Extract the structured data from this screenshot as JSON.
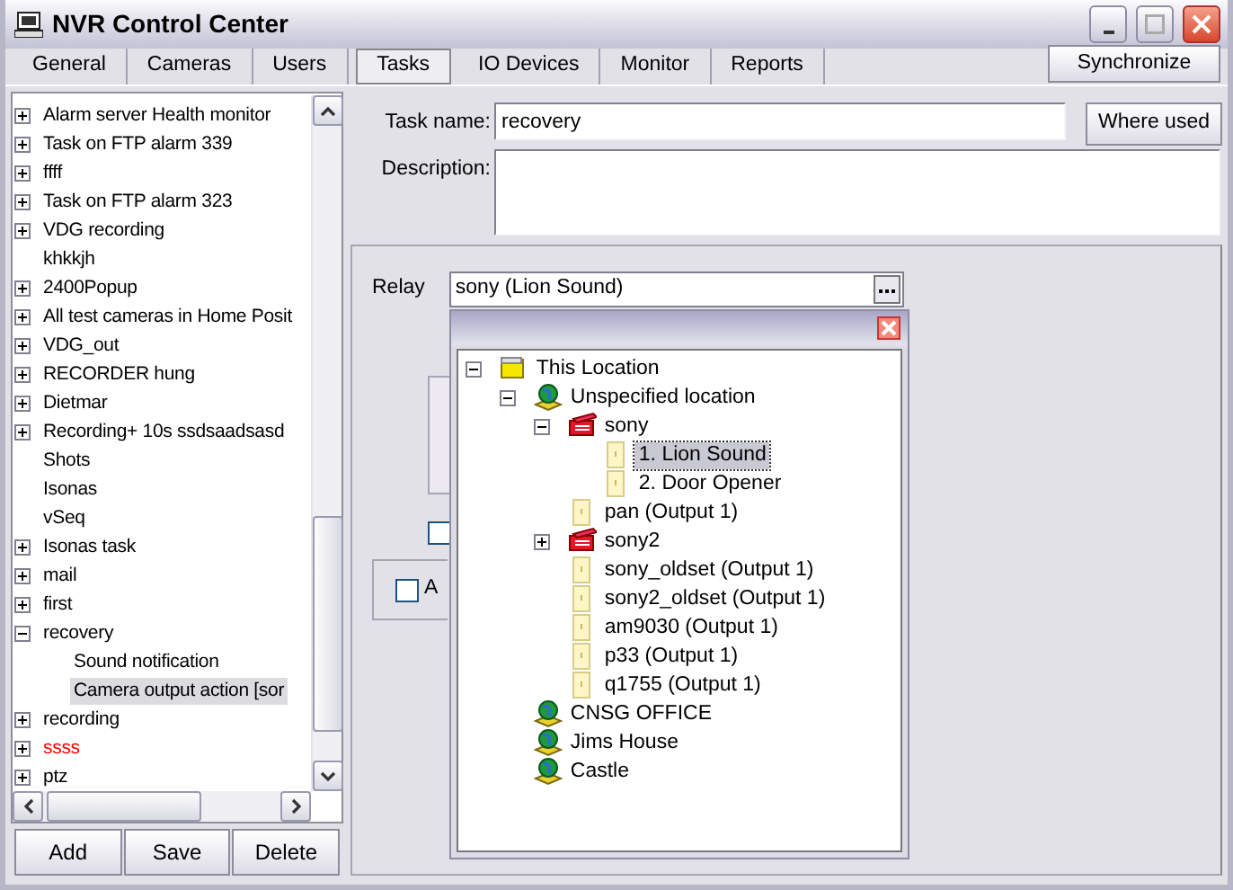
{
  "window": {
    "title": "NVR Control Center"
  },
  "tabs": [
    {
      "label": "General",
      "selected": false
    },
    {
      "label": "Cameras",
      "selected": false
    },
    {
      "label": "Users",
      "selected": false
    },
    {
      "label": "Tasks",
      "selected": true
    },
    {
      "label": "IO Devices",
      "selected": false
    },
    {
      "label": "Monitor",
      "selected": false
    },
    {
      "label": "Reports",
      "selected": false
    }
  ],
  "synchronize_button": "Synchronize",
  "task_tree": {
    "items": [
      {
        "label": "Alarm server Health monitor",
        "expanded": false,
        "selected": false
      },
      {
        "label": "Task on FTP alarm 339",
        "expanded": false,
        "selected": false
      },
      {
        "label": "ffff",
        "expanded": false,
        "selected": false
      },
      {
        "label": "Task on FTP alarm 323",
        "expanded": false,
        "selected": false
      },
      {
        "label": "VDG recording",
        "expanded": false,
        "selected": false
      },
      {
        "label": "khkkjh",
        "selected": false
      },
      {
        "label": "2400Popup",
        "expanded": false,
        "selected": false
      },
      {
        "label": "All test cameras in Home Posit",
        "expanded": false,
        "selected": false
      },
      {
        "label": "VDG_out",
        "expanded": false,
        "selected": false
      },
      {
        "label": "RECORDER hung",
        "expanded": false,
        "selected": false
      },
      {
        "label": "Dietmar",
        "expanded": false,
        "selected": false
      },
      {
        "label": "Recording+ 10s ssdsaadsasd",
        "expanded": false,
        "selected": false
      },
      {
        "label": "Shots",
        "selected": false
      },
      {
        "label": "Isonas",
        "selected": false
      },
      {
        "label": "vSeq",
        "selected": false
      },
      {
        "label": "Isonas task",
        "expanded": false,
        "selected": false
      },
      {
        "label": "mail",
        "expanded": false,
        "selected": false
      },
      {
        "label": "first",
        "expanded": false,
        "selected": false
      },
      {
        "label": "recovery",
        "expanded": true,
        "selected": false,
        "children": [
          {
            "label": "Sound notification",
            "selected": false
          },
          {
            "label": "Camera output action [sor",
            "selected": true
          }
        ]
      },
      {
        "label": "recording",
        "expanded": false,
        "selected": false
      },
      {
        "label": "ssss",
        "expanded": false,
        "selected": false,
        "color": "#ff0000"
      },
      {
        "label": "ptz",
        "expanded": false,
        "selected": false
      }
    ]
  },
  "tree_buttons": [
    "Add",
    "Save",
    "Delete"
  ],
  "task_name": {
    "label": "Task name:",
    "value": "recovery"
  },
  "where_used_button": "Where used",
  "description": {
    "label": "Description:"
  },
  "relay": {
    "label": "Relay",
    "value": "sony (Lion Sound)"
  },
  "hidden_controls": {
    "checkbox": {
      "checked": false
    },
    "group_checkbox": {
      "label": "A",
      "checked": false
    }
  },
  "relay_picker": {
    "items": [
      {
        "label": "This Location",
        "kind": "folder",
        "expanded": true,
        "selected": false,
        "children": [
          {
            "label": "Unspecified location",
            "kind": "location",
            "expanded": true,
            "selected": false,
            "children": [
              {
                "label": "sony",
                "kind": "device",
                "expanded": true,
                "selected": false,
                "children": [
                  {
                    "label": "1. Lion Sound",
                    "kind": "output",
                    "selected": true
                  },
                  {
                    "label": "2. Door Opener",
                    "kind": "output",
                    "selected": false
                  }
                ]
              },
              {
                "label": "pan (Output 1)",
                "kind": "output",
                "selected": false
              },
              {
                "label": "sony2",
                "kind": "device",
                "expanded": false,
                "selected": false
              },
              {
                "label": "sony_oldset (Output 1)",
                "kind": "output",
                "selected": false
              },
              {
                "label": "sony2_oldset (Output 1)",
                "kind": "output",
                "selected": false
              },
              {
                "label": "am9030 (Output 1)",
                "kind": "output",
                "selected": false
              },
              {
                "label": "p33 (Output 1)",
                "kind": "output",
                "selected": false
              },
              {
                "label": "q1755 (Output 1)",
                "kind": "output",
                "selected": false
              }
            ]
          },
          {
            "label": "CNSG OFFICE",
            "kind": "location",
            "selected": false
          },
          {
            "label": "Jims House",
            "kind": "location",
            "selected": false
          },
          {
            "label": "Castle",
            "kind": "location",
            "selected": false
          }
        ]
      }
    ]
  }
}
